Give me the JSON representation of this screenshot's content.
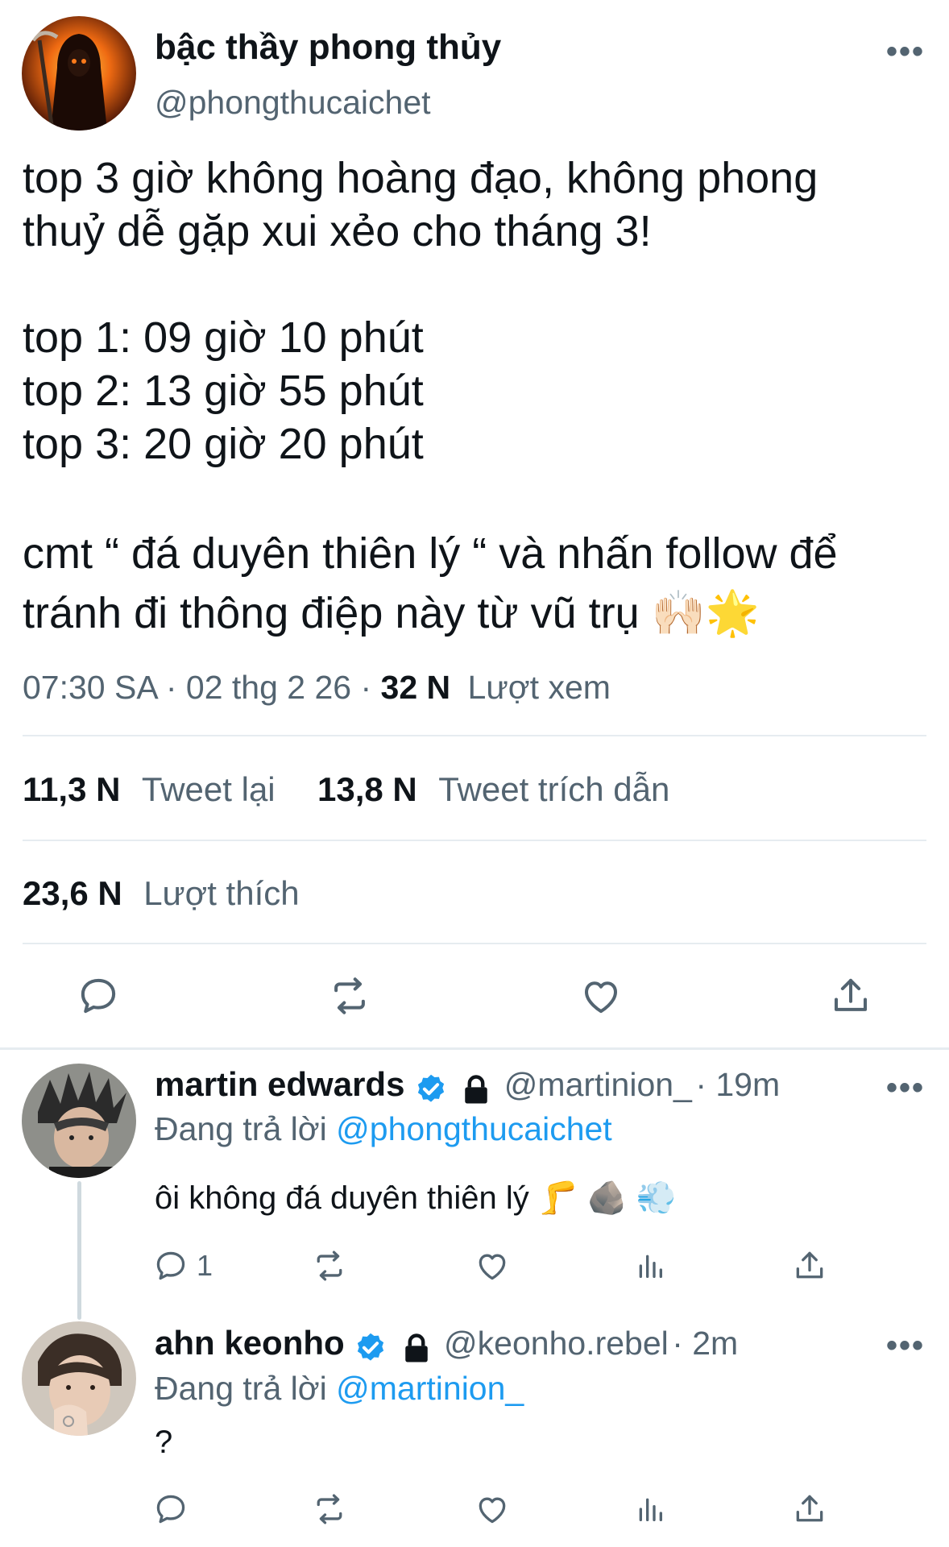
{
  "main_tweet": {
    "author_name": "bậc thầy phong thủy",
    "author_handle": "@phongthucaichet",
    "more_icon": "more-horizontal-icon",
    "text_lines": [
      "top 3 giờ không hoàng đạo, không phong",
      "thuỷ dễ gặp xui xẻo cho tháng 3!",
      "",
      "top 1: 09 giờ 10 phút",
      "top 2: 13 giờ 55 phút",
      "top 3: 20 giờ 20 phút",
      "",
      "cmt “ đá duyên thiên lý “ và nhấn follow để",
      "tránh đi thông điệp này từ vũ trụ 🙌🏻🌟"
    ],
    "time": "07:30 SA",
    "date": "02 thg 2 26",
    "views_count": "32 N",
    "views_label": "Lượt xem",
    "retweets_count": "11,3 N",
    "retweets_label": "Tweet lại",
    "quotes_count": "13,8 N",
    "quotes_label": "Tweet trích dẫn",
    "likes_count": "23,6 N",
    "likes_label": "Lượt thích"
  },
  "replies": [
    {
      "author_name": "martin edwards",
      "author_handle": "@martinion_",
      "time": "19m",
      "replying_label": "Đang trả lời",
      "replying_to": "@phongthucaichet",
      "text": "ôi không đá duyên thiên lý 🦵 🪨 💨",
      "reply_count": "1"
    },
    {
      "author_name": "ahn keonho",
      "author_handle": "@keonho.rebel",
      "time": "2m",
      "replying_label": "Đang trả lời",
      "replying_to": "@martinion_",
      "text": "?",
      "reply_count": ""
    }
  ],
  "colors": {
    "link": "#1d9bf0",
    "secondary_text": "#536471",
    "divider": "#e6ecf0",
    "verified": "#1d9bf0"
  }
}
